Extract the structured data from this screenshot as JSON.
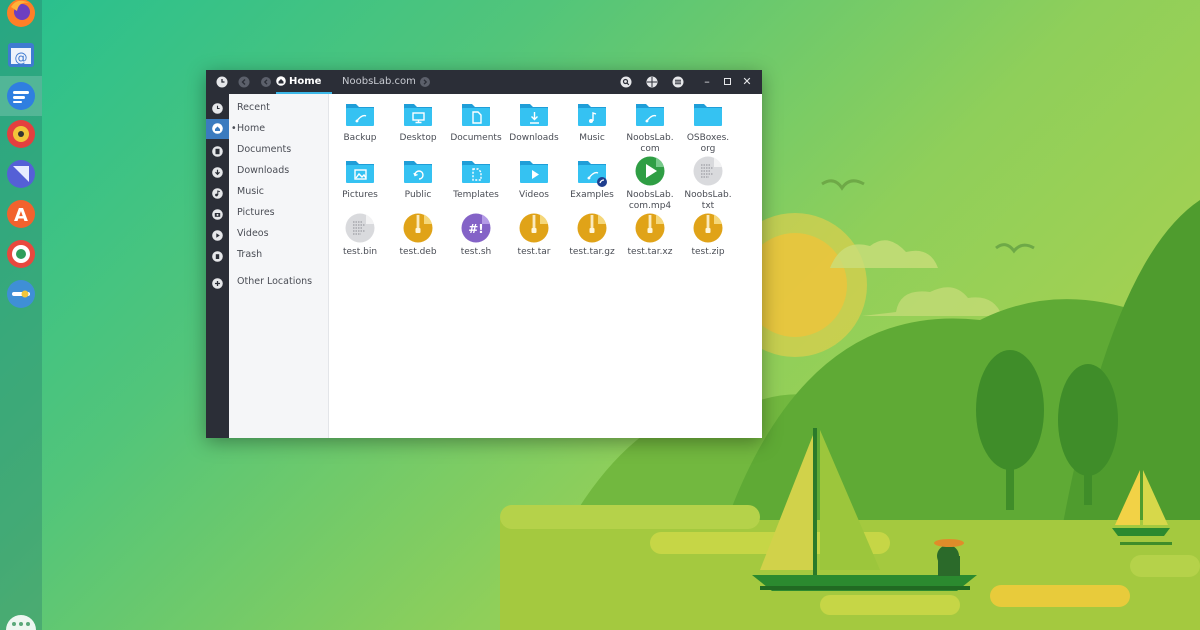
{
  "headerbar": {
    "path_home": "Home",
    "path_next": "NoobsLab.com"
  },
  "sidebar": {
    "items": [
      {
        "label": "Recent",
        "icon": "clock-icon"
      },
      {
        "label": "Home",
        "icon": "home-icon",
        "current": true
      },
      {
        "label": "Documents",
        "icon": "document-icon"
      },
      {
        "label": "Downloads",
        "icon": "download-icon"
      },
      {
        "label": "Music",
        "icon": "music-icon"
      },
      {
        "label": "Pictures",
        "icon": "camera-icon"
      },
      {
        "label": "Videos",
        "icon": "play-icon"
      },
      {
        "label": "Trash",
        "icon": "trash-icon"
      },
      {
        "label": "Other Locations",
        "icon": "plus-icon"
      }
    ]
  },
  "files": [
    {
      "label": "Backup",
      "kind": "folder",
      "glyph": "backup"
    },
    {
      "label": "Desktop",
      "kind": "folder",
      "glyph": "desktop"
    },
    {
      "label": "Documents",
      "kind": "folder",
      "glyph": "document"
    },
    {
      "label": "Downloads",
      "kind": "folder",
      "glyph": "download"
    },
    {
      "label": "Music",
      "kind": "folder",
      "glyph": "music"
    },
    {
      "label": "NoobsLab.\ncom",
      "kind": "folder",
      "glyph": "backup"
    },
    {
      "label": "OSBoxes.\norg",
      "kind": "folder",
      "glyph": "none"
    },
    {
      "label": "Pictures",
      "kind": "folder",
      "glyph": "picture"
    },
    {
      "label": "Public",
      "kind": "folder",
      "glyph": "share"
    },
    {
      "label": "Templates",
      "kind": "folder",
      "glyph": "template"
    },
    {
      "label": "Videos",
      "kind": "folder",
      "glyph": "video"
    },
    {
      "label": "Examples",
      "kind": "folder-link",
      "glyph": "backup"
    },
    {
      "label": "NoobsLab.\ncom.mp4",
      "kind": "video"
    },
    {
      "label": "NoobsLab.\ntxt",
      "kind": "text"
    },
    {
      "label": "test.bin",
      "kind": "text"
    },
    {
      "label": "test.deb",
      "kind": "archive"
    },
    {
      "label": "test.sh",
      "kind": "script",
      "glyph_text": "#!"
    },
    {
      "label": "test.tar",
      "kind": "archive"
    },
    {
      "label": "test.tar.gz",
      "kind": "archive"
    },
    {
      "label": "test.tar.xz",
      "kind": "archive"
    },
    {
      "label": "test.zip",
      "kind": "archive"
    }
  ],
  "colors": {
    "folder_back": "#1f9ed8",
    "folder_front": "#35c2f2",
    "archive": "#e0a318",
    "script": "#8463c7",
    "video": "#2f9e44",
    "text": "#d9dadd"
  },
  "dock": {
    "apps": [
      {
        "name": "firefox-icon"
      },
      {
        "name": "mail-icon"
      },
      {
        "name": "files-icon",
        "active": true
      },
      {
        "name": "music-player-icon"
      },
      {
        "name": "notes-icon"
      },
      {
        "name": "software-center-icon"
      },
      {
        "name": "help-icon"
      },
      {
        "name": "settings-icon"
      }
    ]
  }
}
